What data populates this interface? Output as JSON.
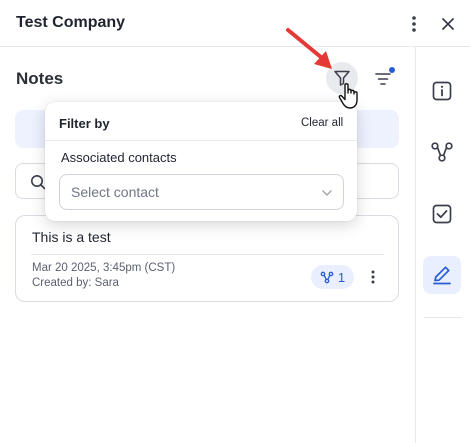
{
  "header": {
    "title": "Test Company"
  },
  "notes": {
    "title": "Notes",
    "search_placeholder": "",
    "items": [
      {
        "text": "This is a test",
        "date": "Mar 20 2025, 3:45pm (CST)",
        "created_by": "Created by: Sara",
        "associations_count": "1"
      }
    ]
  },
  "filter_popover": {
    "title": "Filter by",
    "clear_label": "Clear all",
    "section_label": "Associated contacts",
    "select_placeholder": "Select contact"
  },
  "rail": {
    "items": [
      "info-icon",
      "associations-icon",
      "tasks-icon",
      "notes-icon"
    ],
    "active": "notes-icon"
  },
  "colors": {
    "accent": "#2a5bd7",
    "accent_light": "#e9efff",
    "annotation_arrow": "#e53935"
  }
}
